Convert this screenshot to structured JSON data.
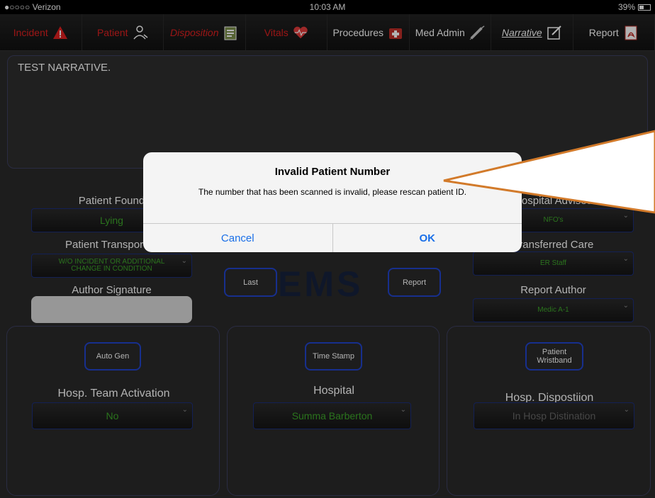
{
  "status": {
    "carrier": "●○○○○ Verizon",
    "time": "10:03 AM",
    "battery": "39%"
  },
  "tabs": [
    {
      "label": "Incident",
      "icon": "warning-icon"
    },
    {
      "label": "Patient",
      "icon": "person-icon"
    },
    {
      "label": "Disposition",
      "icon": "clipboard-icon"
    },
    {
      "label": "Vitals",
      "icon": "heart-icon"
    },
    {
      "label": "Procedures",
      "icon": "medkit-icon"
    },
    {
      "label": "Med Admin",
      "icon": "syringe-icon"
    },
    {
      "label": "Narrative",
      "icon": "edit-icon"
    },
    {
      "label": "Report",
      "icon": "pdf-icon"
    }
  ],
  "narrative": {
    "text": "TEST NARRATIVE."
  },
  "left": {
    "patient_found_label": "Patient Found",
    "patient_found_value": "Lying",
    "patient_transport_label": "Patient Transported",
    "patient_transport_value": "W/O INCIDENT OR ADDITIONAL CHANGE IN CONDITION",
    "author_signature_label": "Author Signature"
  },
  "right": {
    "hospital_advised_label": "Hospital Advised",
    "hospital_advised_value": "NFO's",
    "transferred_care_label": "Transferred Care",
    "transferred_care_value": "ER Staff",
    "report_author_label": "Report Author",
    "report_author_value": "Medic A-1"
  },
  "center": {
    "last_button": "Last",
    "report_button": "Report",
    "logo": "EMS"
  },
  "sections": {
    "team_activation": {
      "button": "Auto Gen",
      "label": "Hosp. Team Activation",
      "value": "No"
    },
    "hospital": {
      "button": "Time Stamp",
      "label": "Hospital",
      "value": "Summa Barberton"
    },
    "disposition": {
      "button": "Patient Wristband",
      "label": "Hosp. Dispostiion",
      "value": "In Hosp Distination"
    }
  },
  "alert": {
    "title": "Invalid Patient Number",
    "message": "The number that has been scanned is invalid, please rescan patient ID.",
    "cancel_label": "Cancel",
    "ok_label": "OK"
  },
  "colors": {
    "accent_blue": "#1a6fe8",
    "tab_red": "#e02020",
    "value_green": "#3da52a",
    "outline_blue": "#2244cc"
  }
}
